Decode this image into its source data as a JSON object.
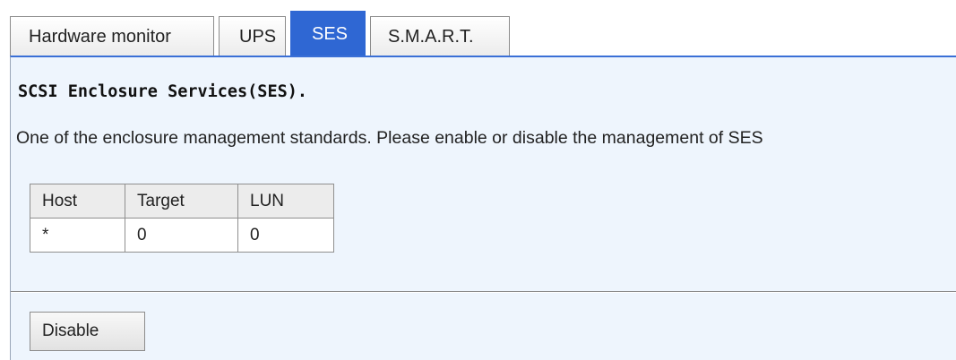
{
  "tabs": [
    {
      "label": "Hardware monitor",
      "active": false
    },
    {
      "label": "UPS",
      "active": false
    },
    {
      "label": "SES",
      "active": true
    },
    {
      "label": "S.M.A.R.T.",
      "active": false
    }
  ],
  "panel": {
    "title": "SCSI Enclosure Services(SES).",
    "description": "One of the enclosure management standards. Please enable or disable the management of SES"
  },
  "table": {
    "headers": [
      "Host",
      "Target",
      "LUN"
    ],
    "rows": [
      [
        "*",
        "0",
        "0"
      ]
    ]
  },
  "actions": {
    "disable_label": "Disable"
  },
  "colors": {
    "active_tab": "#2f67d3",
    "panel_bg": "#eef5fd"
  }
}
